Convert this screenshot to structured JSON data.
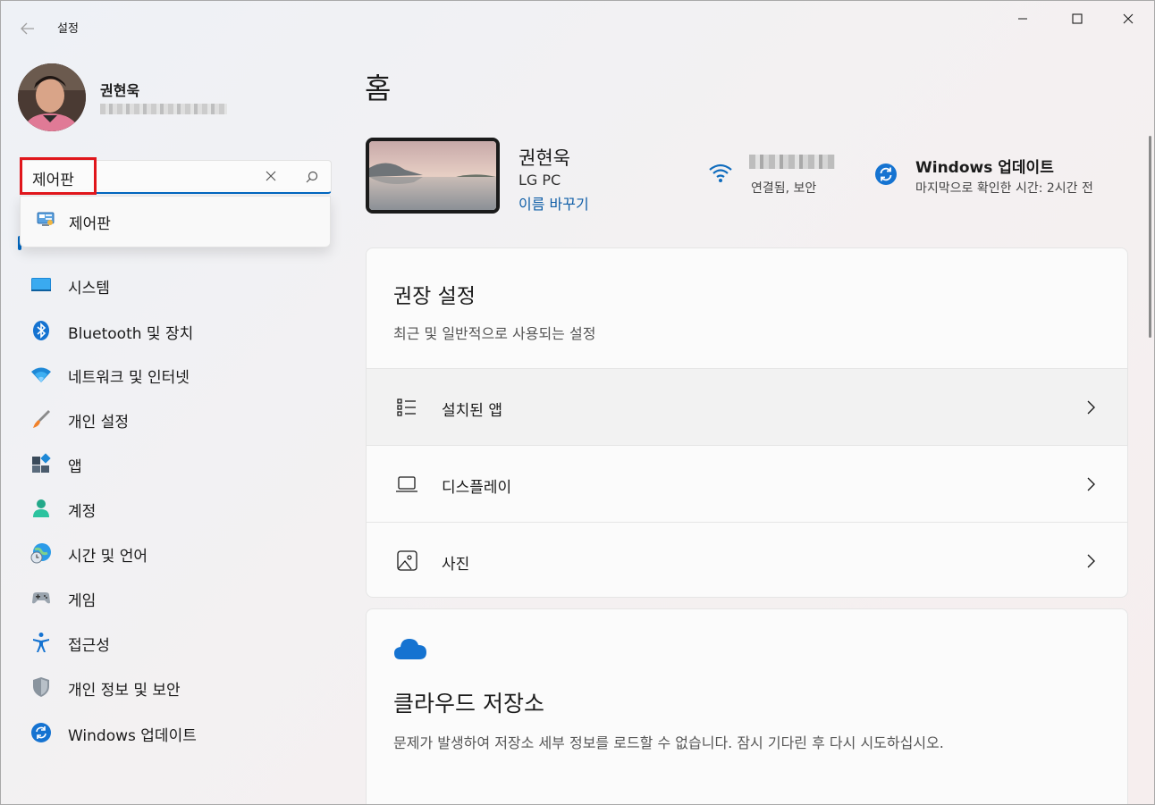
{
  "window": {
    "title": "설정"
  },
  "user": {
    "name": "권현욱"
  },
  "search": {
    "value": "제어판",
    "suggestions": [
      {
        "label": "제어판"
      }
    ]
  },
  "nav": [
    {
      "id": "system",
      "label": "시스템",
      "icon": "monitor-icon"
    },
    {
      "id": "bluetooth",
      "label": "Bluetooth 및 장치",
      "icon": "bluetooth-icon"
    },
    {
      "id": "network",
      "label": "네트워크 및 인터넷",
      "icon": "wifi-icon"
    },
    {
      "id": "personalization",
      "label": "개인 설정",
      "icon": "paintbrush-icon"
    },
    {
      "id": "apps",
      "label": "앱",
      "icon": "apps-icon"
    },
    {
      "id": "accounts",
      "label": "계정",
      "icon": "person-icon"
    },
    {
      "id": "time-language",
      "label": "시간 및 언어",
      "icon": "globe-clock-icon"
    },
    {
      "id": "gaming",
      "label": "게임",
      "icon": "gamepad-icon"
    },
    {
      "id": "accessibility",
      "label": "접근성",
      "icon": "accessibility-icon"
    },
    {
      "id": "privacy",
      "label": "개인 정보 및 보안",
      "icon": "shield-icon"
    },
    {
      "id": "windows-update",
      "label": "Windows 업데이트",
      "icon": "update-icon"
    }
  ],
  "main": {
    "title": "홈",
    "device": {
      "name": "권현욱",
      "model": "LG PC",
      "rename": "이름 바꾸기"
    },
    "network": {
      "status": "연결됨, 보안"
    },
    "update": {
      "title": "Windows 업데이트",
      "subtitle": "마지막으로 확인한 시간: 2시간 전"
    },
    "recommended": {
      "title": "권장 설정",
      "subtitle": "최근 및 일반적으로 사용되는 설정",
      "items": [
        {
          "label": "설치된 앱",
          "icon": "list-icon"
        },
        {
          "label": "디스플레이",
          "icon": "laptop-icon"
        },
        {
          "label": "사진",
          "icon": "image-icon"
        }
      ]
    },
    "cloud": {
      "title": "클라우드 저장소",
      "description": "문제가 발생하여 저장소 세부 정보를 로드할 수 없습니다. 잠시 기다린 후 다시 시도하십시오."
    }
  },
  "colors": {
    "accent": "#0067c0",
    "highlight": "#e0161b",
    "link": "#0f5ea7"
  }
}
